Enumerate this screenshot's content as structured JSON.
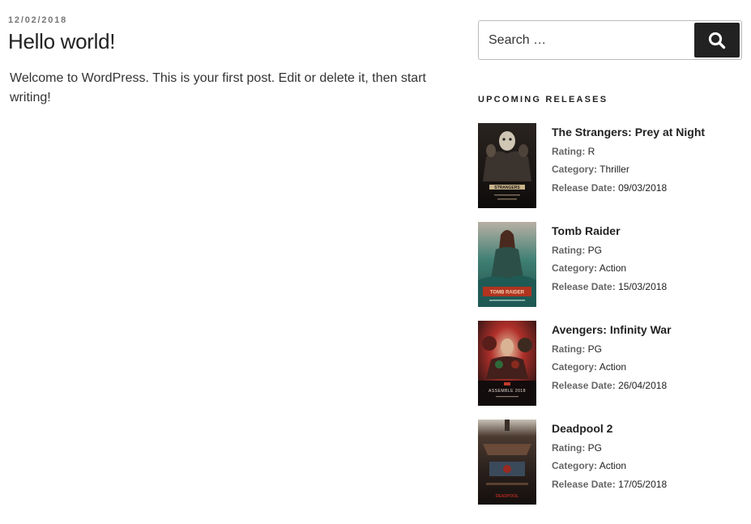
{
  "post": {
    "date": "12/02/2018",
    "title": "Hello world!",
    "body": "Welcome to WordPress. This is your first post. Edit or delete it, then start writing!"
  },
  "search": {
    "placeholder": "Search …",
    "icon": "search-icon"
  },
  "widget": {
    "title": "UPCOMING RELEASES",
    "labels": {
      "rating": "Rating:",
      "category": "Category:",
      "release_date": "Release Date:"
    },
    "movies": [
      {
        "title": "The Strangers: Prey at Night",
        "rating": "R",
        "category": "Thriller",
        "release_date": "09/03/2018",
        "poster_text": "STRANGERS"
      },
      {
        "title": "Tomb Raider",
        "rating": "PG",
        "category": "Action",
        "release_date": "15/03/2018",
        "poster_text": "TOMB RAIDER"
      },
      {
        "title": "Avengers: Infinity War",
        "rating": "PG",
        "category": "Action",
        "release_date": "26/04/2018",
        "poster_text": "ASSEMBLE 2018"
      },
      {
        "title": "Deadpool 2",
        "rating": "PG",
        "category": "Action",
        "release_date": "17/05/2018",
        "poster_text": "DEADPOOL"
      }
    ]
  }
}
